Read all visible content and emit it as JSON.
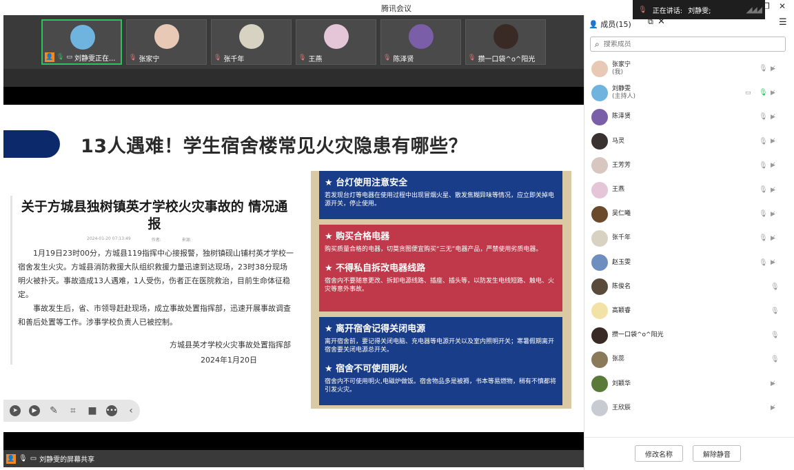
{
  "window": {
    "title": "腾讯会议",
    "speaking_label": "正在讲话:",
    "speaking_name": "刘静雯;",
    "restore_icon": "restore-icon",
    "close_icon": "close-icon"
  },
  "video_tiles": [
    {
      "name": "刘静雯正在...",
      "active": true,
      "avatar_color": "#6fb4de"
    },
    {
      "name": "张家宁",
      "active": false,
      "avatar_color": "#e8c9b6"
    },
    {
      "name": "张千年",
      "active": false,
      "avatar_color": "#d8d2c2"
    },
    {
      "name": "王燕",
      "active": false,
      "avatar_color": "#e4c6d8"
    },
    {
      "name": "陈泽贤",
      "active": false,
      "avatar_color": "#7a5fa8"
    },
    {
      "name": "攒一口袋^o^阳光",
      "active": false,
      "avatar_color": "#3a2a26"
    }
  ],
  "slide": {
    "headline": "13人遇难！学生宿舍楼常见火灾隐患有哪些？",
    "notice_title": "关于方城县独树镇英才学校火灾事故的 情况通报",
    "notice_meta": [
      "2024-01-20 07:13:49",
      "作者:",
      "来源:"
    ],
    "notice_paragraphs": [
      "1月19日23时00分，方城县119指挥中心接报警，独树镇砚山铺村英才学校一宿舍发生火灾。方城县消防救援大队组织救援力量迅速到达现场，23时38分现场明火被扑灭。事故造成13人遇难，1人受伤，伤者正在医院救治，目前生命体征稳定。",
      "事故发生后，省、市领导赶赴现场，成立事故处置指挥部，迅速开展事故调查和善后处置等工作。涉事学校负责人已被控制。"
    ],
    "notice_signature": "方城县英才学校火灾事故处置指挥部",
    "notice_date": "2024年1月20日",
    "panels": [
      {
        "color": "blue",
        "sections": [
          {
            "title": "★ 台灯使用注意安全",
            "text": "若发现台灯等电器在使用过程中出现冒烟火星、散发焦糊异味等情况，应立即关掉电源开关，停止使用。"
          }
        ]
      },
      {
        "color": "red",
        "sections": [
          {
            "title": "★ 购买合格电器",
            "text": "购买质量合格的电器，切莫贪图便宜购买“三无”电器产品，严禁使用劣质电器。"
          },
          {
            "title": "★ 不得私自拆改电器线路",
            "text": "宿舍内不要随意更改、拆卸电源线路、插座、插头等，以防发生电线短路、触电、火灾等意外事故。"
          }
        ]
      },
      {
        "color": "blue",
        "sections": [
          {
            "title": "★ 离开宿舍记得关闭电源",
            "text": "离开宿舍前，要记得关闭电脑、充电器等电源开关以及室内照明开关；寒暑假期离开宿舍要关闭电源总开关。"
          },
          {
            "title": "★ 宿舍不可使用明火",
            "text": "宿舍内不可使用明火,电磁炉做饭。宿舍物品多是被褥，书本等易燃物，稍有不慎都将引发火灾。"
          }
        ]
      }
    ]
  },
  "toolbar": {
    "icons": [
      "pointer-icon",
      "play-icon",
      "pen-icon",
      "screenshot-icon",
      "camera-icon",
      "more-icon",
      "collapse-icon"
    ]
  },
  "share_bar": {
    "label": "刘静雯的屏幕共享"
  },
  "members_panel": {
    "title": "成员(15)",
    "search_placeholder": "搜索成员",
    "members": [
      {
        "name": "张家宁",
        "role": "(我)",
        "mic": "muted",
        "cam": "off",
        "share": false,
        "avatar_color": "#e8c9b6"
      },
      {
        "name": "刘静雯",
        "role": "(主持人)",
        "mic": "on",
        "cam": "off",
        "share": true,
        "avatar_color": "#6fb4de"
      },
      {
        "name": "陈泽贤",
        "role": "",
        "mic": "muted",
        "cam": "off",
        "share": false,
        "avatar_color": "#7a5fa8"
      },
      {
        "name": "马灵",
        "role": "",
        "mic": "muted",
        "cam": "off",
        "share": false,
        "avatar_color": "#3a3230"
      },
      {
        "name": "王芳芳",
        "role": "",
        "mic": "muted",
        "cam": "off",
        "share": false,
        "avatar_color": "#d8c6c0"
      },
      {
        "name": "王燕",
        "role": "",
        "mic": "muted",
        "cam": "off",
        "share": false,
        "avatar_color": "#e4c6d8"
      },
      {
        "name": "吴仁曦",
        "role": "",
        "mic": "muted",
        "cam": "off",
        "share": false,
        "avatar_color": "#6a4a2a"
      },
      {
        "name": "张千年",
        "role": "",
        "mic": "muted",
        "cam": "off",
        "share": false,
        "avatar_color": "#d8d2c2"
      },
      {
        "name": "赵玉雯",
        "role": "",
        "mic": "muted",
        "cam": "off",
        "share": false,
        "avatar_color": "#6e8ec0"
      },
      {
        "name": "陈俊名",
        "role": "",
        "mic": "muted",
        "cam": "none",
        "share": false,
        "avatar_color": "#5a4a3a"
      },
      {
        "name": "高颖睿",
        "role": "",
        "mic": "muted",
        "cam": "none",
        "share": false,
        "avatar_color": "#f2e2a6"
      },
      {
        "name": "攒一口袋^o^阳光",
        "role": "",
        "mic": "muted",
        "cam": "none",
        "share": false,
        "avatar_color": "#3a2a26"
      },
      {
        "name": "张蕊",
        "role": "",
        "mic": "muted",
        "cam": "none",
        "share": false,
        "avatar_color": "#8a7a5a"
      },
      {
        "name": "刘颖华",
        "role": "",
        "mic": "none",
        "cam": "off",
        "share": false,
        "avatar_color": "#5a7a3a"
      },
      {
        "name": "王欣辰",
        "role": "",
        "mic": "none",
        "cam": "off",
        "share": false,
        "avatar_color": "#c8ccd2"
      }
    ],
    "rename_button": "修改名称",
    "unmute_button": "解除静音"
  }
}
